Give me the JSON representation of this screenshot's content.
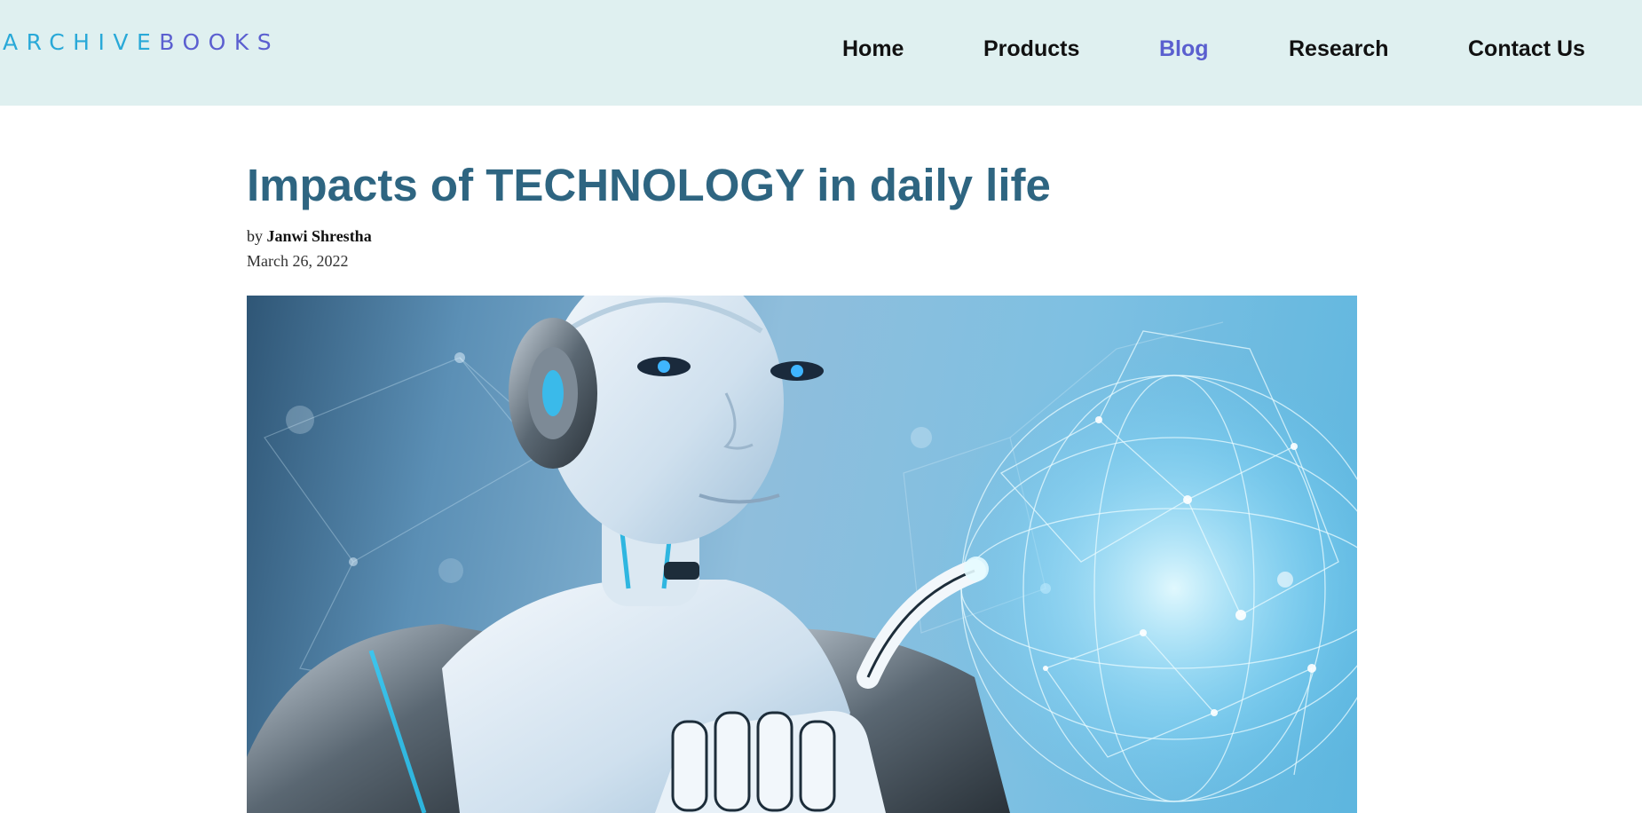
{
  "site": {
    "logo_part1": "ARCHIVE",
    "logo_part2": "BOOKS"
  },
  "nav": {
    "items": [
      {
        "label": "Home",
        "active": false
      },
      {
        "label": "Products",
        "active": false
      },
      {
        "label": "Blog",
        "active": true
      },
      {
        "label": "Research",
        "active": false
      },
      {
        "label": "Contact Us",
        "active": false
      }
    ]
  },
  "post": {
    "title": "Impacts of TECHNOLOGY in daily life",
    "by_prefix": "by",
    "author": "Janwi Shrestha",
    "date": "March 26, 2022"
  },
  "colors": {
    "header_bg": "#dff0f0",
    "nav_active": "#5a5fcf",
    "title": "#2e6581",
    "logo_cyan": "#29a9d8",
    "logo_indigo": "#5b5fd0"
  },
  "hero_image": {
    "icon": "robot-with-network-globe-image"
  }
}
